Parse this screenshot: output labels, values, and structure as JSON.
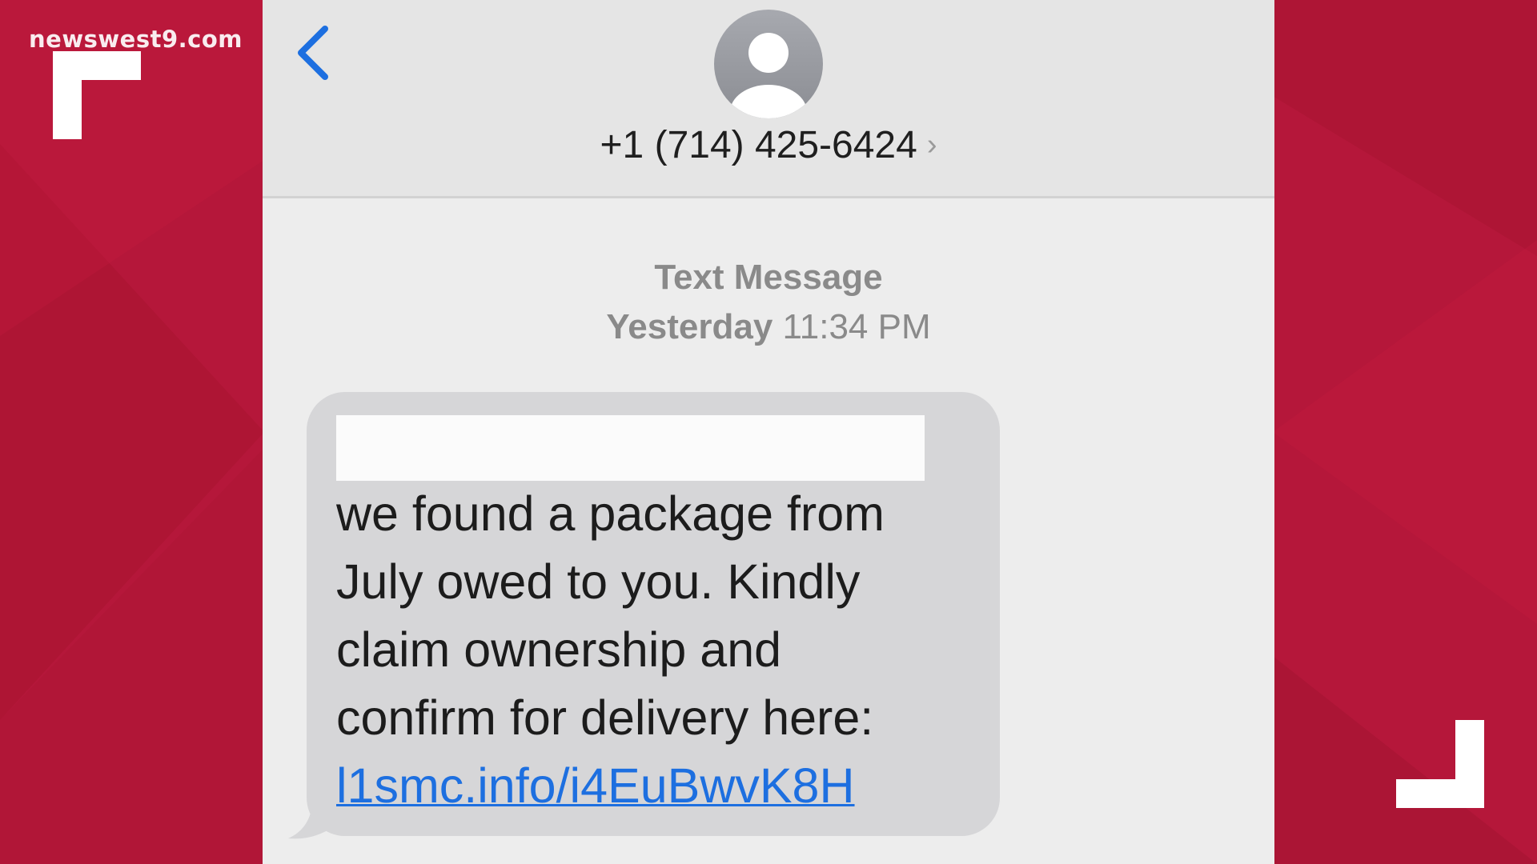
{
  "watermark": "newswest9.com",
  "colors": {
    "background_red": "#b5173a",
    "ios_blue": "#1d6fe0",
    "bubble_gray": "#d6d6d8",
    "screen_gray": "#ededed"
  },
  "header": {
    "back_icon": "chevron-left-icon",
    "avatar_icon": "contact-avatar-icon",
    "contact_number": "+1 (714) 425-6424",
    "contact_chevron": "›"
  },
  "conversation": {
    "service_label": "Text Message",
    "day_label": "Yesterday",
    "time_label": "11:34 PM"
  },
  "message": {
    "lines": [
      "we found a package from",
      "July owed to you. Kindly",
      "claim ownership and",
      "confirm for delivery here:"
    ],
    "link": "l1smc.info/i4EuBwvK8H"
  }
}
